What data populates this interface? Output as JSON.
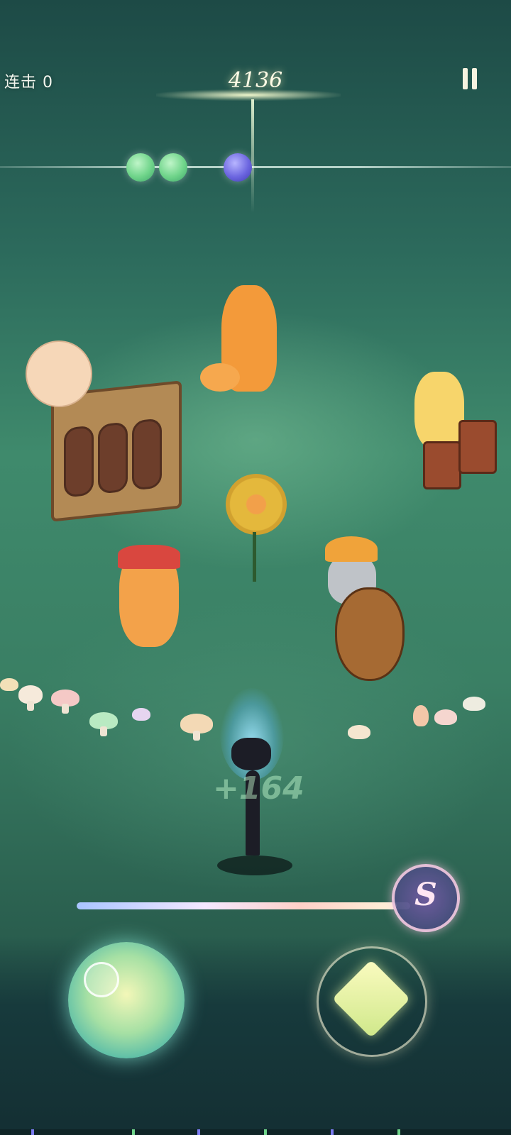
{
  "hud": {
    "combo_label": "连击 0",
    "score": "4136",
    "pause_icon": "pause-icon"
  },
  "notes": [
    {
      "color": "green"
    },
    {
      "color": "green"
    },
    {
      "color": "blue"
    }
  ],
  "hit_feedback": "+164",
  "skill": {
    "letter": "S",
    "icon": "skill-s-icon"
  },
  "song_progress": 0.96,
  "colors": {
    "note_green": "#6fd48a",
    "note_blue": "#6c66e0",
    "accent_glow": "#fffbe6"
  }
}
